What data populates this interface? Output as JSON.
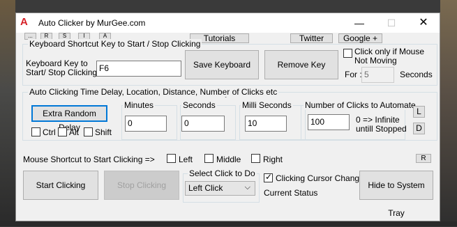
{
  "window": {
    "title": "Auto Clicker by MurGee.com",
    "app_icon": "A"
  },
  "window_controls": {
    "minimize": "—",
    "maximize": "☐",
    "close": "✕"
  },
  "toolbar": {
    "tiny_buttons": [
      "...",
      "R",
      "S",
      "I",
      "A"
    ],
    "tutorials": "Tutorials",
    "twitter": "Twitter",
    "google": "Google +"
  },
  "keyboard_group": {
    "title": "Keyboard Shortcut Key to Start / Stop Clicking",
    "key_label_line1": "Keyboard Key to",
    "key_label_line2": "Start/ Stop Clicking :",
    "key_value": "F6",
    "save_button": "Save Keyboard Key",
    "remove_button": "Remove Key",
    "click_only_label_line1": "Click only if Mouse",
    "click_only_label_line2": "Not Moving",
    "for_label": "For :",
    "for_value": "5",
    "seconds_label": "Seconds"
  },
  "timing_group": {
    "title": "Auto Clicking Time Delay, Location, Distance, Number of Clicks etc",
    "extra_random_button": "Extra Random Delay",
    "ctrl_label": "Ctrl",
    "alt_label": "Alt",
    "shift_label": "Shift",
    "minutes_label": "Minutes",
    "minutes_value": "0",
    "seconds_label": "Seconds",
    "seconds_value": "0",
    "milli_label": "Milli Seconds",
    "milli_value": "10"
  },
  "clicks_group": {
    "title": "Number of Clicks to Automate",
    "value": "100",
    "info_line1": "0 => Infinite",
    "info_line2": "untill Stopped"
  },
  "side_buttons": {
    "l": "L",
    "d": "D",
    "r": "R"
  },
  "mouse_shortcut": {
    "label": "Mouse Shortcut to Start Clicking =>",
    "left": "Left",
    "middle": "Middle",
    "right": "Right"
  },
  "bottom": {
    "start_button": "Start Clicking",
    "stop_button": "Stop Clicking",
    "select_click_title": "Select Click to Do",
    "select_click_value": "Left Click",
    "cursor_change_label": "Clicking Cursor Change",
    "current_status_label": "Current Status",
    "hide_button": "Hide to System Tray"
  }
}
